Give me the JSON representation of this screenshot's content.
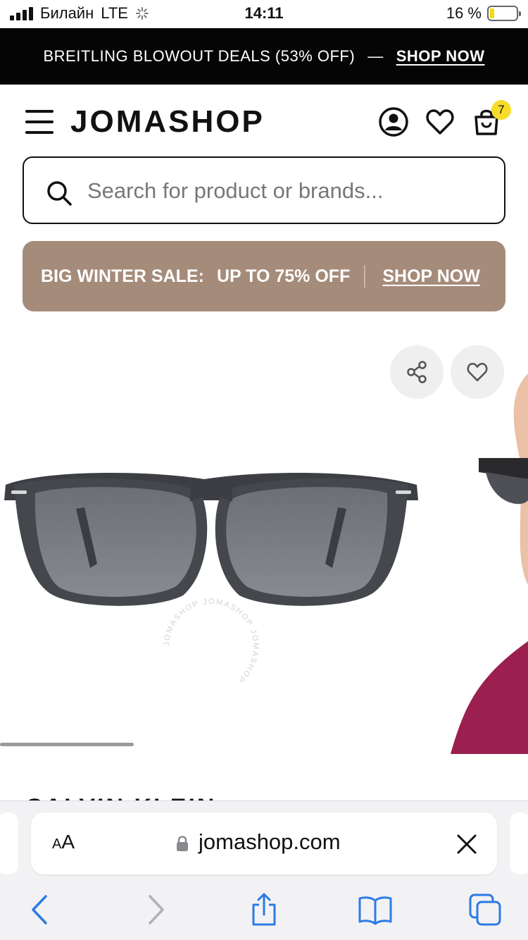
{
  "status_bar": {
    "carrier": "Билайн",
    "network": "LTE",
    "time": "14:11",
    "battery": "16 %",
    "battery_level": 0.16
  },
  "promo": {
    "text": "BREITLING BLOWOUT DEALS (53% OFF)",
    "dash": "—",
    "link": "SHOP NOW"
  },
  "header": {
    "logo": "JOMASHOP",
    "cart_count": "7",
    "icons": [
      "menu-icon",
      "account-icon",
      "heart-icon",
      "shopping-bag-icon"
    ]
  },
  "search": {
    "placeholder": "Search for product or brands..."
  },
  "sale_banner": {
    "prefix": "BIG WINTER SALE:",
    "offer": "UP TO 75% OFF",
    "link": "SHOP NOW",
    "background": "#a58b7a"
  },
  "product": {
    "watermark": "JOMASHOP JOMASHOP JOMASHOP ",
    "cut_title": "CALVIN KLEIN"
  },
  "safari": {
    "text_size_label": "AA",
    "domain": "jomashop.com",
    "icons": [
      "lock-icon",
      "close-icon",
      "back-icon",
      "forward-icon",
      "share-icon",
      "bookmarks-icon",
      "tabs-icon"
    ]
  }
}
